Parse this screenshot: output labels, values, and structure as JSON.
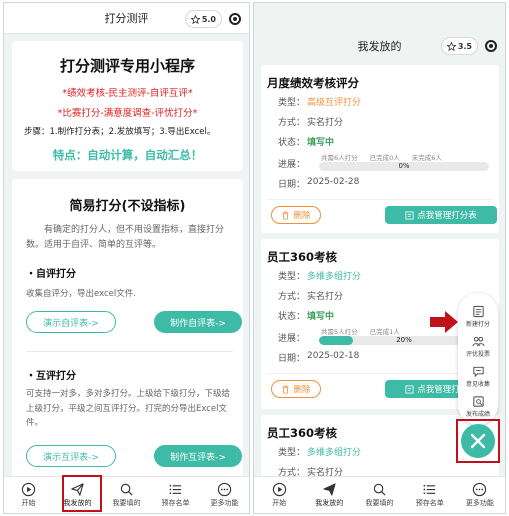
{
  "left": {
    "title": "打分测评",
    "score": "5.0",
    "hero": {
      "title": "打分测评专用小程序",
      "line1": "*绩效考核-民主测评-自评互评*",
      "line2": "*比赛打分-满意度调查-评优打分*",
      "steps": "步骤：1.制作打分表；2.发放填写；3.导出Excel。",
      "feature": "特点：自动计算，自动汇总！"
    },
    "simple": {
      "title": "简易打分(不设指标)",
      "desc": "有确定的打分人，但不用设置指标，直接打分数。适用于自评、简单的互评等。",
      "self_title": "・自评打分",
      "self_desc": "收集自评分，导出excel文件.",
      "self_demo": "演示自评表->",
      "self_make": "制作自评表->",
      "mutual_title": "・互评打分",
      "mutual_desc": "可支持一对多，多对多打分。上级给下级打分，下级给上级打分，平级之间互评打分。打完的分导出Excel文件。",
      "mutual_demo": "演示互评表->",
      "mutual_make": "制作互评表->"
    }
  },
  "right": {
    "title": "我发放的",
    "score": "3.5",
    "cards": [
      {
        "title": "月度绩效考核评分",
        "type_label": "类型：",
        "type_value": "高级互评打分",
        "method_label": "方式：",
        "method_value": "实名打分",
        "status_label": "状态：",
        "status_value": "填写中",
        "progress_label": "进展：",
        "p_total": "共需6人打分",
        "p_done": "已完成0人",
        "p_todo": "未完成6人",
        "progress_text": "0%",
        "progress_fraction": 0,
        "date_label": "日期：",
        "date_value": "2025-02-28",
        "delete": "删除",
        "manage": "点我管理打分表"
      },
      {
        "title": "员工360考核",
        "type_label": "类型：",
        "type_value": "多维多组打分",
        "method_label": "方式：",
        "method_value": "实名打分",
        "status_label": "状态：",
        "status_value": "填写中",
        "progress_label": "进展：",
        "p_total": "共需5人打分",
        "p_done": "已完成1人",
        "p_todo": "",
        "progress_text": "20%",
        "progress_fraction": 0.2,
        "date_label": "日期：",
        "date_value": "2025-02-18",
        "delete": "删除",
        "manage": "点我管理打分表"
      },
      {
        "title": "员工360考核",
        "type_label": "类型：",
        "type_value": "多维多组打分",
        "method_label": "方式：",
        "method_value": "实名打分"
      }
    ],
    "side_menu": [
      "新建打分",
      "评优投票",
      "意见收集",
      "发布成绩"
    ]
  },
  "tabs": [
    "开始",
    "我发放的",
    "我要填的",
    "预存名单",
    "更多功能"
  ],
  "colors": {
    "accent": "#3dbba6",
    "red": "#e02020",
    "orange": "#f0903c",
    "highlight": "#c0101a"
  }
}
